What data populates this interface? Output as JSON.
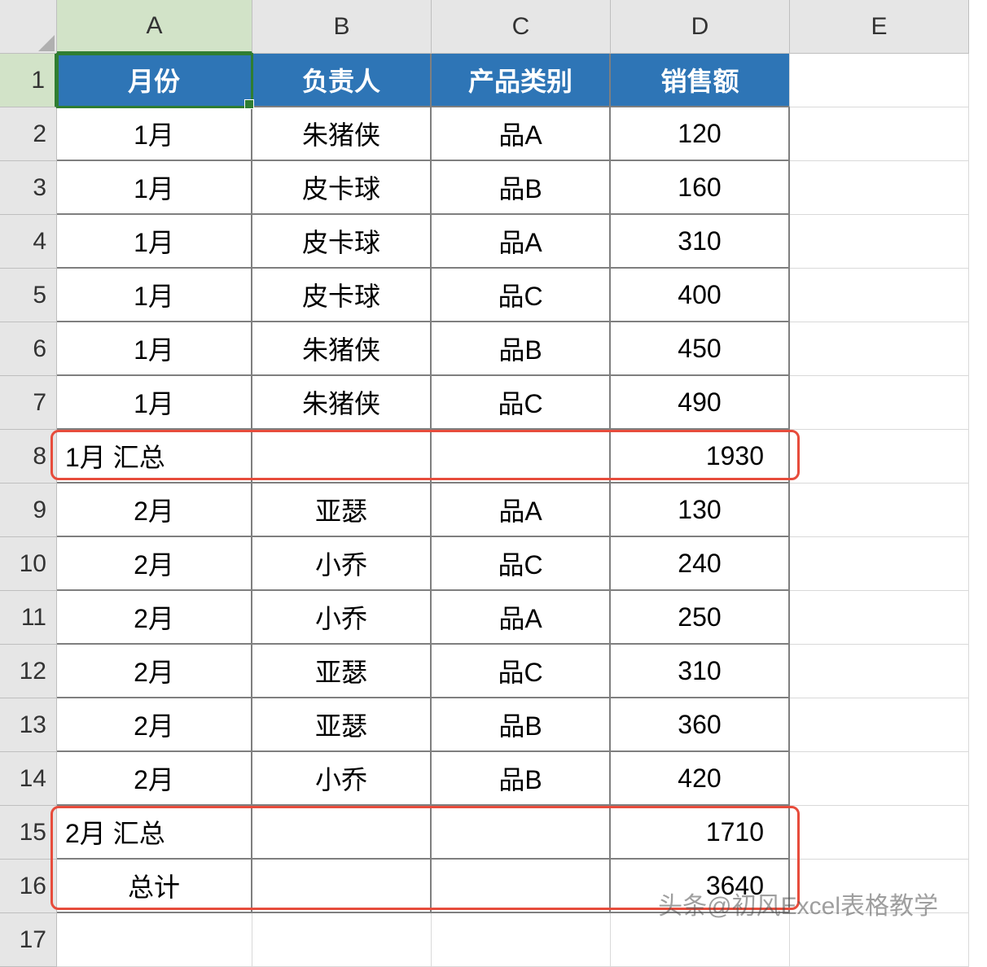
{
  "columns": [
    "A",
    "B",
    "C",
    "D",
    "E"
  ],
  "rowCount": 17,
  "selectedCell": "A1",
  "headers": {
    "month": "月份",
    "owner": "负责人",
    "category": "产品类别",
    "sales": "销售额"
  },
  "rows": [
    {
      "r": 2,
      "month": "1月",
      "owner": "朱猪侠",
      "category": "品A",
      "sales": "120"
    },
    {
      "r": 3,
      "month": "1月",
      "owner": "皮卡球",
      "category": "品B",
      "sales": "160"
    },
    {
      "r": 4,
      "month": "1月",
      "owner": "皮卡球",
      "category": "品A",
      "sales": "310"
    },
    {
      "r": 5,
      "month": "1月",
      "owner": "皮卡球",
      "category": "品C",
      "sales": "400"
    },
    {
      "r": 6,
      "month": "1月",
      "owner": "朱猪侠",
      "category": "品B",
      "sales": "450"
    },
    {
      "r": 7,
      "month": "1月",
      "owner": "朱猪侠",
      "category": "品C",
      "sales": "490"
    },
    {
      "r": 8,
      "subtotal": true,
      "label": "1月 汇总",
      "sales": "1930"
    },
    {
      "r": 9,
      "month": "2月",
      "owner": "亚瑟",
      "category": "品A",
      "sales": "130"
    },
    {
      "r": 10,
      "month": "2月",
      "owner": "小乔",
      "category": "品C",
      "sales": "240"
    },
    {
      "r": 11,
      "month": "2月",
      "owner": "小乔",
      "category": "品A",
      "sales": "250"
    },
    {
      "r": 12,
      "month": "2月",
      "owner": "亚瑟",
      "category": "品C",
      "sales": "310"
    },
    {
      "r": 13,
      "month": "2月",
      "owner": "亚瑟",
      "category": "品B",
      "sales": "360"
    },
    {
      "r": 14,
      "month": "2月",
      "owner": "小乔",
      "category": "品B",
      "sales": "420"
    },
    {
      "r": 15,
      "subtotal": true,
      "label": "2月 汇总",
      "sales": "1710"
    },
    {
      "r": 16,
      "grandtotal": true,
      "label": "总计",
      "sales": "3640"
    }
  ],
  "watermark": "头条@初风Excel表格教学",
  "colors": {
    "headerBg": "#2e75b6",
    "highlight": "#e74c3c",
    "selection": "#2f7d32"
  }
}
